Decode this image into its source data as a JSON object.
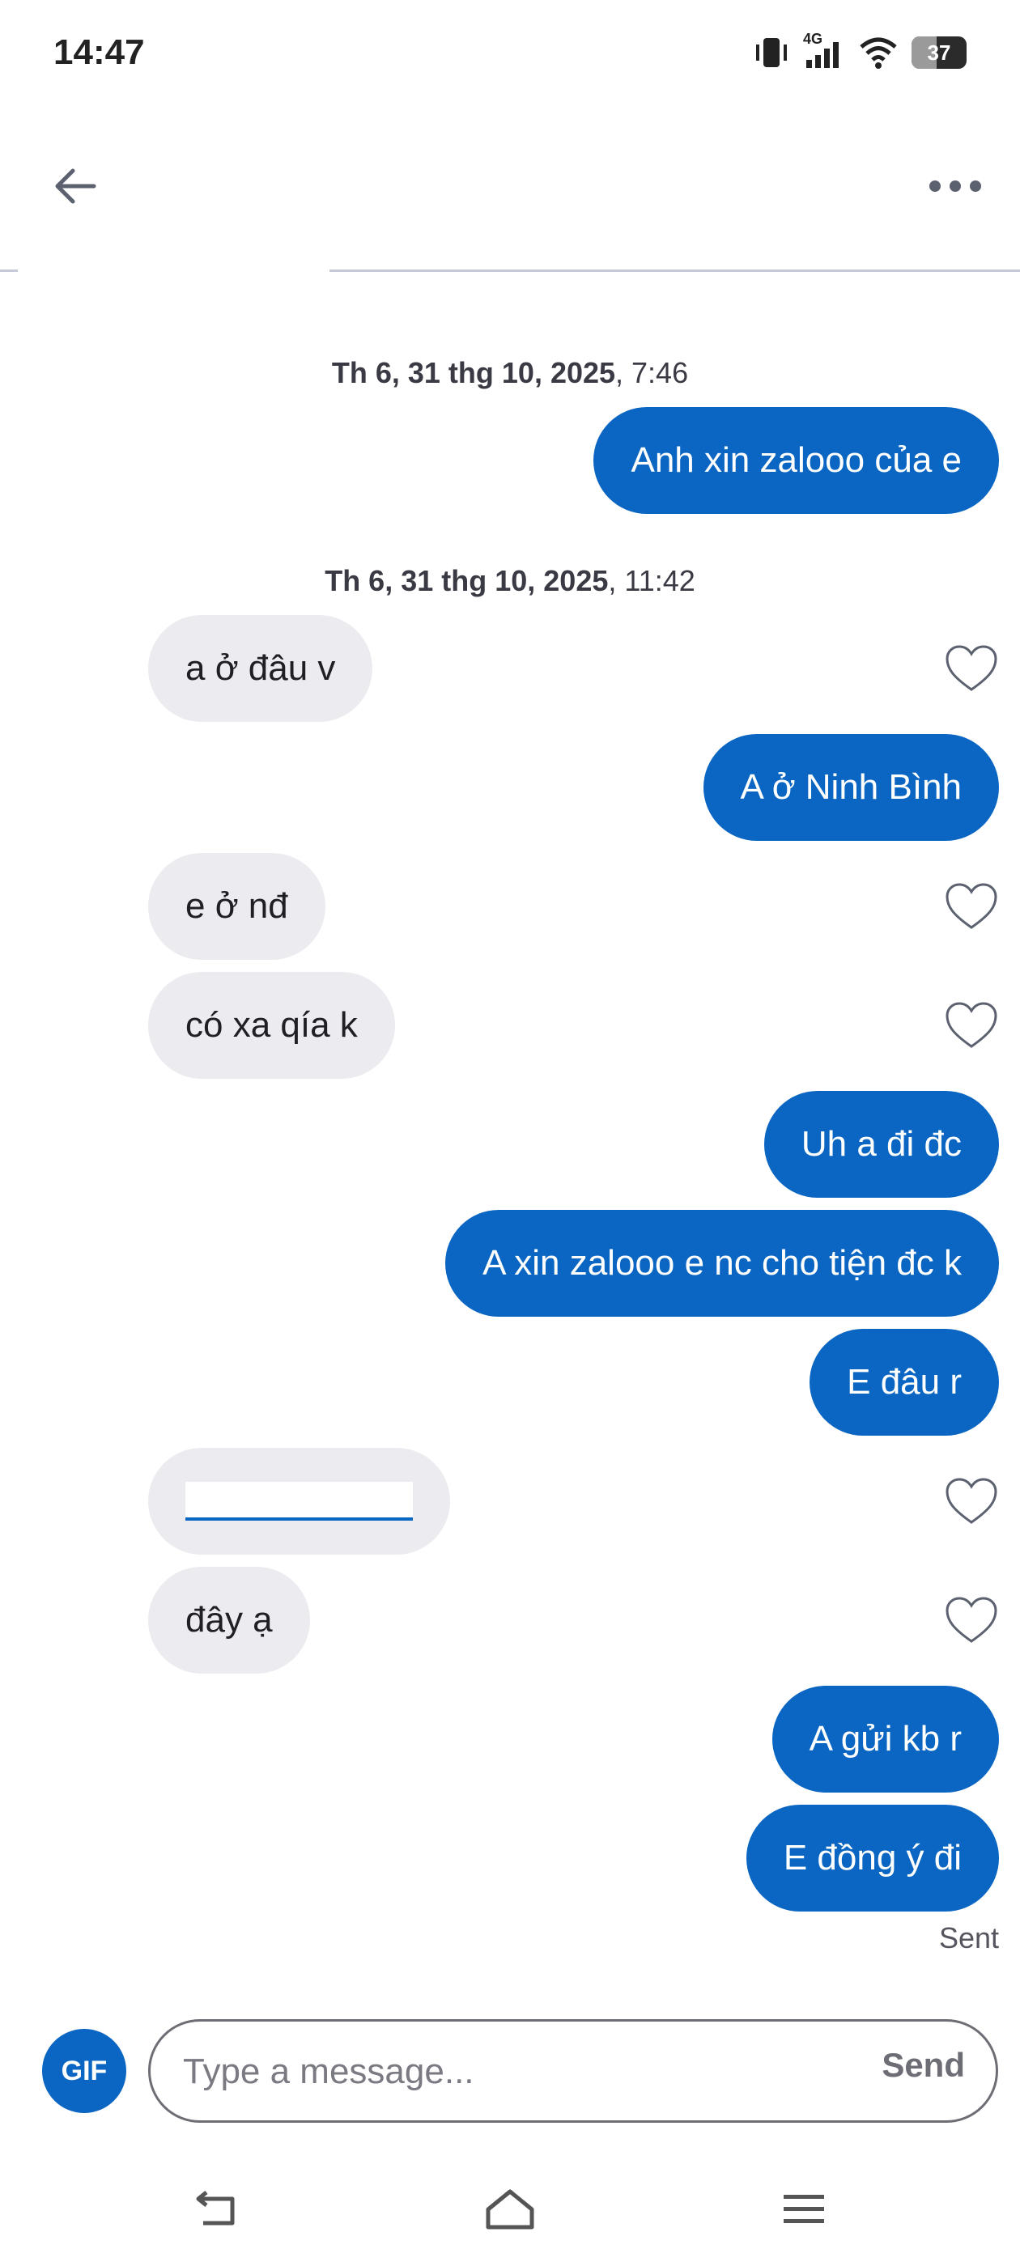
{
  "status_bar": {
    "time": "14:47",
    "network": "4G",
    "battery": "37"
  },
  "header": {
    "back_icon": "arrow-left-icon",
    "more_icon": "more-horizontal-icon"
  },
  "conversation": {
    "groups": [
      {
        "date_bold": "Th 6, 31 thg 10, 2025",
        "time": ", 7:46"
      },
      {
        "date_bold": "Th 6, 31 thg 10, 2025",
        "time": ", 11:42"
      }
    ],
    "messages": [
      {
        "side": "out",
        "text": "Anh xin zalooo của e"
      },
      {
        "side": "in",
        "text": "a ở đâu v"
      },
      {
        "side": "out",
        "text": "A ở Ninh Bình"
      },
      {
        "side": "in",
        "text": "e ở nđ"
      },
      {
        "side": "in",
        "text": "có xa qía k"
      },
      {
        "side": "out",
        "text": "Uh a đi đc"
      },
      {
        "side": "out",
        "text": "A xin zalooo e nc cho tiện đc k"
      },
      {
        "side": "out",
        "text": "E đâu r"
      },
      {
        "side": "in",
        "text": "",
        "type": "link"
      },
      {
        "side": "in",
        "text": "đây ạ"
      },
      {
        "side": "out",
        "text": "A gửi kb r"
      },
      {
        "side": "out",
        "text": "E đồng ý đi"
      }
    ],
    "sent_status": "Sent"
  },
  "composer": {
    "gif_label": "GIF",
    "placeholder": "Type a message...",
    "send_label": "Send"
  },
  "colors": {
    "accent": "#0a66c2",
    "incoming_bubble": "#ececf0"
  }
}
